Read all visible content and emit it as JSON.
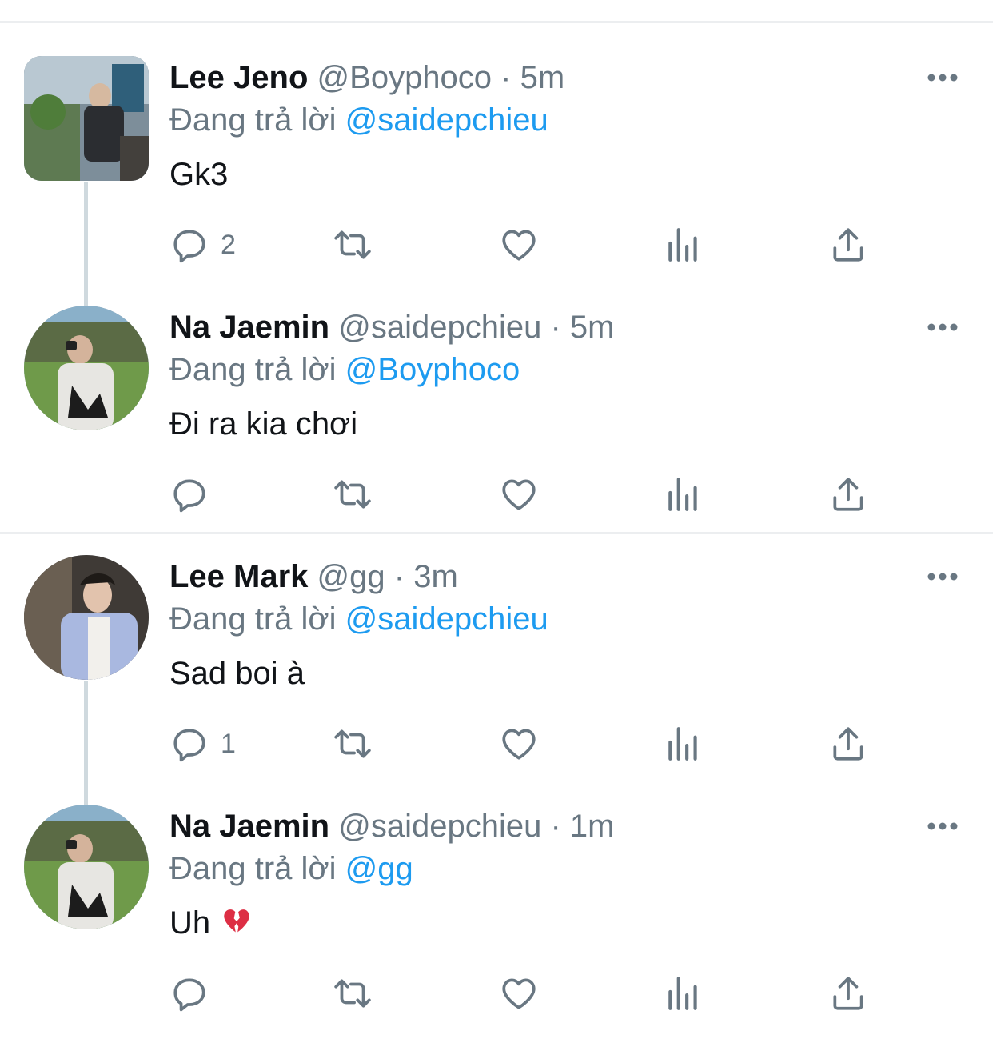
{
  "tweets": [
    {
      "name": "Lee Jeno",
      "handle": "@Boyphoco",
      "separator": "·",
      "time": "5m",
      "reply_prefix": "Đang trả lời",
      "reply_to": "@saidepchieu",
      "text": "Gk3",
      "reply_count": "2",
      "avatar_shape": "square",
      "emoji": ""
    },
    {
      "name": "Na Jaemin",
      "handle": "@saidepchieu",
      "separator": "·",
      "time": "5m",
      "reply_prefix": "Đang trả lời",
      "reply_to": "@Boyphoco",
      "text": "Đi ra kia chơi",
      "reply_count": "",
      "avatar_shape": "round",
      "emoji": ""
    },
    {
      "name": "Lee Mark",
      "handle": "@gg",
      "separator": "·",
      "time": "3m",
      "reply_prefix": "Đang trả lời",
      "reply_to": "@saidepchieu",
      "text": "Sad boi à",
      "reply_count": "1",
      "avatar_shape": "round",
      "emoji": ""
    },
    {
      "name": "Na Jaemin",
      "handle": "@saidepchieu",
      "separator": "·",
      "time": "1m",
      "reply_prefix": "Đang trả lời",
      "reply_to": "@gg",
      "text": "Uh",
      "reply_count": "",
      "avatar_shape": "round",
      "emoji": "broken-heart-icon"
    }
  ],
  "colors": {
    "name": "#111418",
    "secondary": "#697782",
    "link": "#1d9bf0",
    "divider": "#eceef0",
    "thread_line": "#cfd9de",
    "broken_heart": "#dd2e44"
  },
  "icons": [
    "reply-icon",
    "retweet-icon",
    "like-icon",
    "views-icon",
    "share-icon",
    "more-icon"
  ]
}
